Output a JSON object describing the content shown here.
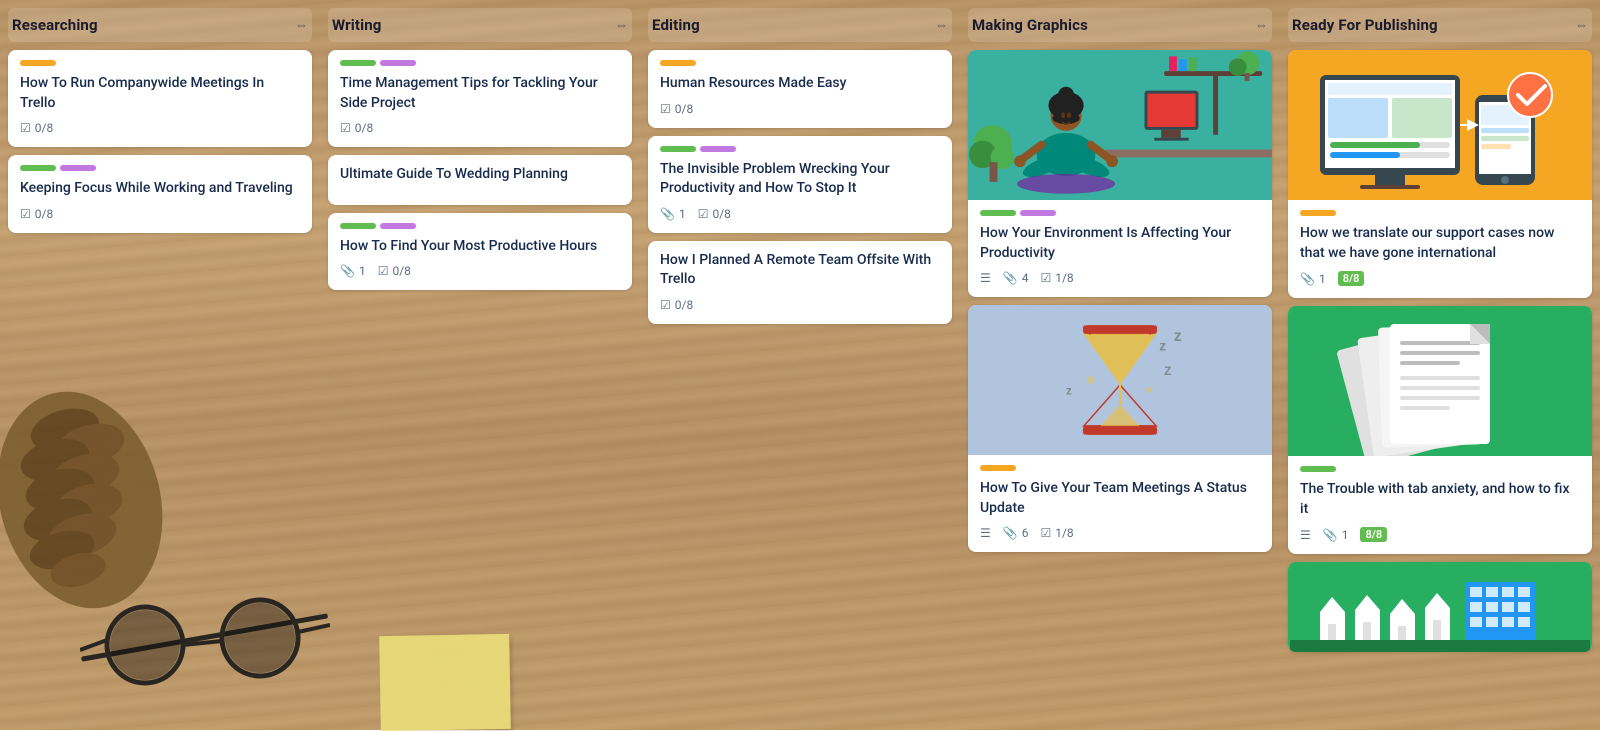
{
  "board": {
    "background": "wood",
    "columns": [
      {
        "id": "researching",
        "title": "Researching",
        "actions": "⇔",
        "cards": [
          {
            "id": "r1",
            "labels": [
              "yellow"
            ],
            "title": "How To Run Companywide Meetings In Trello",
            "checklist": "0/8",
            "attachments": null,
            "image": null
          },
          {
            "id": "r2",
            "labels": [
              "green",
              "purple"
            ],
            "title": "Keeping Focus While Working and Traveling",
            "checklist": "0/8",
            "attachments": null,
            "image": null
          }
        ]
      },
      {
        "id": "writing",
        "title": "Writing",
        "actions": "⇔",
        "cards": [
          {
            "id": "w1",
            "labels": [
              "green",
              "purple"
            ],
            "title": "Time Management Tips for Tackling Your Side Project",
            "checklist": "0/8",
            "attachments": null,
            "image": null
          },
          {
            "id": "w2",
            "labels": [],
            "title": "Ultimate Guide To Wedding Planning",
            "checklist": null,
            "attachments": null,
            "image": null
          },
          {
            "id": "w3",
            "labels": [
              "green",
              "purple"
            ],
            "title": "How To Find Your Most Productive Hours",
            "checklist": "0/8",
            "attachments": "1",
            "image": null
          }
        ]
      },
      {
        "id": "editing",
        "title": "Editing",
        "actions": "⇔",
        "cards": [
          {
            "id": "e1",
            "labels": [
              "yellow"
            ],
            "title": "Human Resources Made Easy",
            "checklist": "0/8",
            "attachments": null,
            "image": null
          },
          {
            "id": "e2",
            "labels": [
              "green",
              "purple"
            ],
            "title": "The Invisible Problem Wrecking Your Productivity and How To Stop It",
            "checklist": "0/8",
            "attachments": "1",
            "image": null
          },
          {
            "id": "e3",
            "labels": [],
            "title": "How I Planned A Remote Team Offsite With Trello",
            "checklist": "0/8",
            "attachments": null,
            "image": null
          }
        ]
      },
      {
        "id": "making-graphics",
        "title": "Making Graphics",
        "actions": "⇔",
        "cards": [
          {
            "id": "mg1",
            "labels": [
              "green",
              "purple"
            ],
            "title": "How Your Environment Is Affecting Your Productivity",
            "checklist": "1/8",
            "attachments": "4",
            "description": true,
            "image": "woman-working"
          },
          {
            "id": "mg2",
            "labels": [
              "yellow"
            ],
            "title": "How To Give Your Team Meetings A Status Update",
            "checklist": "1/8",
            "attachments": "6",
            "description": true,
            "image": "hourglass"
          }
        ]
      },
      {
        "id": "ready-for-publishing",
        "title": "Ready For Publishing",
        "actions": "⇔",
        "cards": [
          {
            "id": "rfp1",
            "labels": [
              "yellow"
            ],
            "title": "How we translate our support cases now that we have gone international",
            "checklist": "8/8",
            "checklist_complete": true,
            "attachments": "1",
            "image": "publishing-dashboard"
          },
          {
            "id": "rfp2",
            "labels": [
              "green"
            ],
            "title": "The Trouble with tab anxiety, and how to fix it",
            "checklist": "8/8",
            "checklist_complete": true,
            "attachments": "1",
            "description": true,
            "image": "documents"
          },
          {
            "id": "rfp3",
            "labels": [],
            "title": "",
            "checklist": null,
            "image": "real-estate"
          }
        ]
      }
    ]
  },
  "labels": {
    "checklist_icon": "☑",
    "attachment_icon": "📎",
    "description_icon": "☰"
  }
}
